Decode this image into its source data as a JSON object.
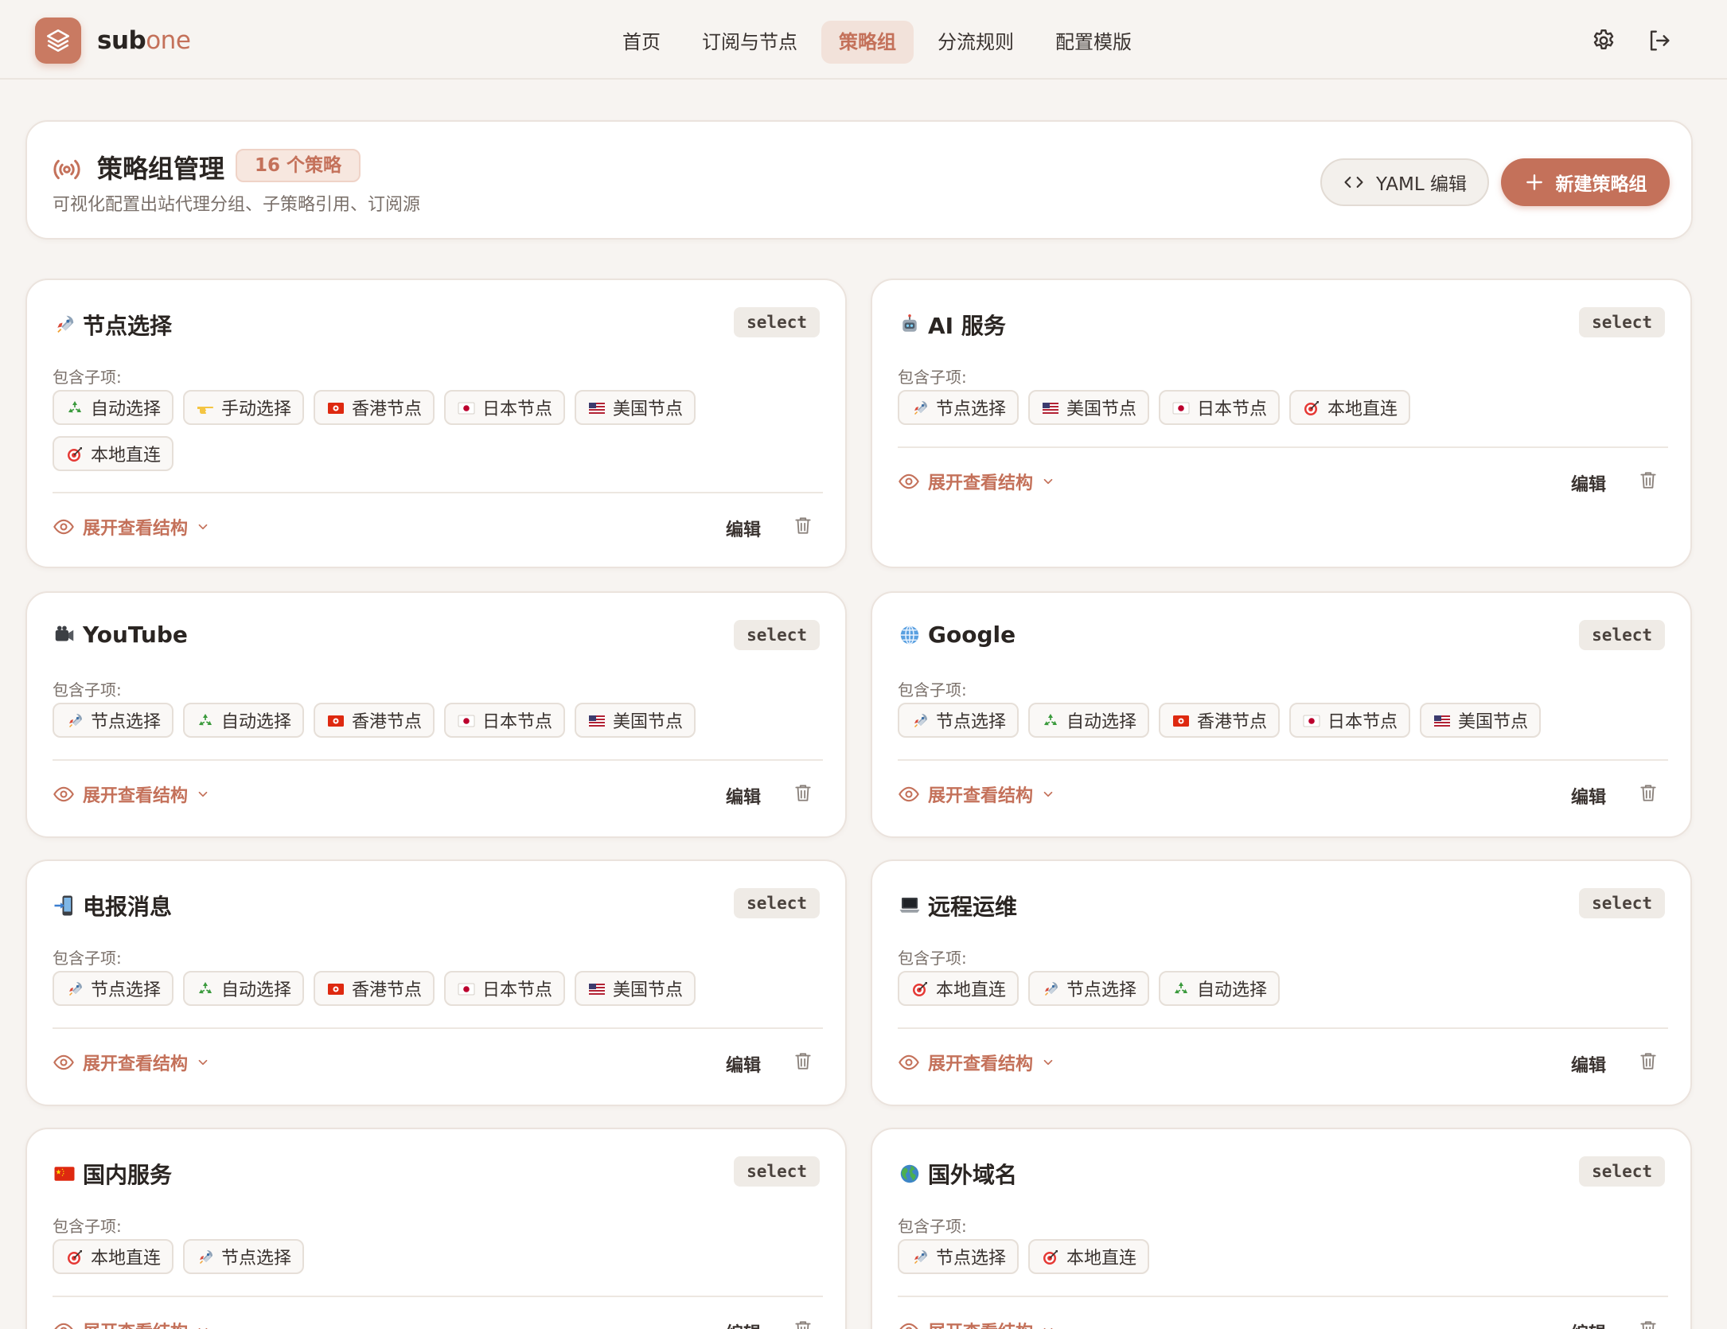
{
  "brand": {
    "name_main": "sub",
    "name_accent": "one"
  },
  "nav": {
    "tabs": [
      "首页",
      "订阅与节点",
      "策略组",
      "分流规则",
      "配置模版"
    ],
    "active_index": 2
  },
  "icons": {
    "settings": "gear-icon",
    "logout": "logout-icon",
    "logo": "layers-icon"
  },
  "header": {
    "title": "策略组管理",
    "count_badge": "16 个策略",
    "subtitle": "可视化配置出站代理分组、子策略引用、订阅源",
    "yaml_button": "YAML 编辑",
    "new_button": "新建策略组"
  },
  "labels": {
    "included": "包含子项:",
    "expand": "展开查看结构",
    "edit": "编辑"
  },
  "colors": {
    "accent": "#c4715a",
    "background": "#f7f4f1"
  },
  "groups": [
    {
      "emoji": "rocket",
      "name": "节点选择",
      "type": "select",
      "items": [
        "自动选择",
        "手动选择",
        "香港节点",
        "日本节点",
        "美国节点",
        "本地直连"
      ]
    },
    {
      "emoji": "robot",
      "name": "AI 服务",
      "type": "select",
      "items": [
        "节点选择",
        "美国节点",
        "日本节点",
        "本地直连"
      ]
    },
    {
      "emoji": "camera",
      "name": "YouTube",
      "type": "select",
      "items": [
        "节点选择",
        "自动选择",
        "香港节点",
        "日本节点",
        "美国节点"
      ]
    },
    {
      "emoji": "globe-meridians",
      "name": "Google",
      "type": "select",
      "items": [
        "节点选择",
        "自动选择",
        "香港节点",
        "日本节点",
        "美国节点"
      ]
    },
    {
      "emoji": "phone-arrow",
      "name": "电报消息",
      "type": "select",
      "items": [
        "节点选择",
        "自动选择",
        "香港节点",
        "日本节点",
        "美国节点"
      ]
    },
    {
      "emoji": "laptop",
      "name": "远程运维",
      "type": "select",
      "items": [
        "本地直连",
        "节点选择",
        "自动选择"
      ]
    },
    {
      "emoji": "flag-cn",
      "name": "国内服务",
      "type": "select",
      "items": [
        "本地直连",
        "节点选择"
      ]
    },
    {
      "emoji": "globe-earth",
      "name": "国外域名",
      "type": "select",
      "items": [
        "节点选择",
        "本地直连"
      ]
    }
  ]
}
